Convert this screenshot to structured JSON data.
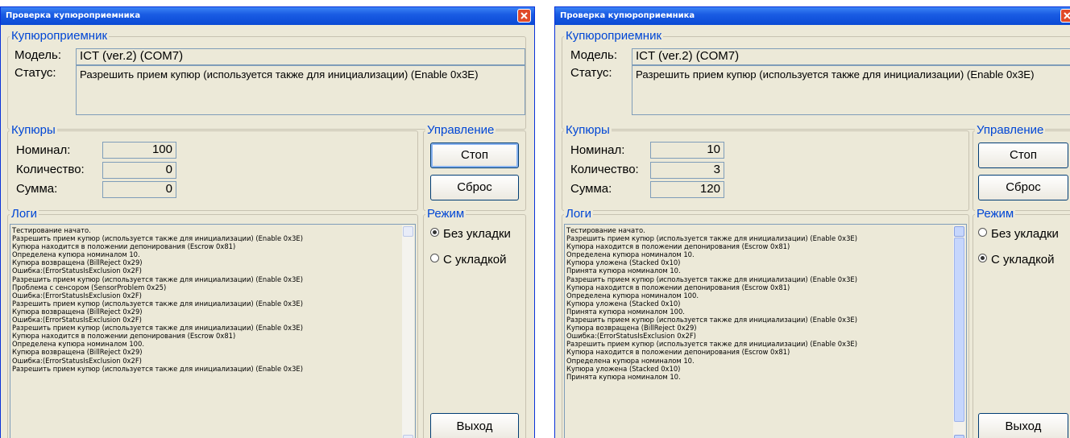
{
  "left": {
    "title": "Проверка купюроприемника",
    "acceptor_group": "Купюроприемник",
    "model_label": "Модель:",
    "model_value": "ICT (ver.2) (COM7)",
    "status_label": "Статус:",
    "status_value": "Разрешить прием купюр (используется также для инициализации) (Enable 0x3E)",
    "bills_group": "Купюры",
    "nominal_label": "Номинал:",
    "nominal_value": "100",
    "count_label": "Количество:",
    "count_value": "0",
    "sum_label": "Сумма:",
    "sum_value": "0",
    "control_group": "Управление",
    "stop_button": "Стоп",
    "reset_button": "Сброс",
    "logs_group": "Логи",
    "mode_group": "Режим",
    "mode_options": [
      "Без укладки",
      "С укладкой"
    ],
    "mode_selected": 0,
    "exit_button": "Выход",
    "logs": [
      "Тестирование начато.",
      "Разрешить прием купюр (используется также для инициализации) (Enable 0x3E)",
      "Купюра находится в положении депонирования (Escrow 0x81)",
      "Определена купюра номиналом 10.",
      "Купюра возвращена (BillReject 0x29)",
      "Ошибка:(ErrorStatusIsExclusion 0x2F)",
      "Разрешить прием купюр (используется также для инициализации) (Enable 0x3E)",
      "Проблема с сенсором (SensorProblem 0x25)",
      "Ошибка:(ErrorStatusIsExclusion 0x2F)",
      "Разрешить прием купюр (используется также для инициализации) (Enable 0x3E)",
      "Купюра возвращена (BillReject 0x29)",
      "Ошибка:(ErrorStatusIsExclusion 0x2F)",
      "Разрешить прием купюр (используется также для инициализации) (Enable 0x3E)",
      "Купюра находится в положении депонирования (Escrow 0x81)",
      "Определена купюра номиналом 100.",
      "Купюра возвращена (BillReject 0x29)",
      "Ошибка:(ErrorStatusIsExclusion 0x2F)",
      "Разрешить прием купюр (используется также для инициализации) (Enable 0x3E)"
    ]
  },
  "right": {
    "title": "Проверка купюроприемника",
    "acceptor_group": "Купюроприемник",
    "model_label": "Модель:",
    "model_value": "ICT (ver.2) (COM7)",
    "status_label": "Статус:",
    "status_value": "Разрешить прием купюр (используется также для инициализации) (Enable 0x3E)",
    "bills_group": "Купюры",
    "nominal_label": "Номинал:",
    "nominal_value": "10",
    "count_label": "Количество:",
    "count_value": "3",
    "sum_label": "Сумма:",
    "sum_value": "120",
    "control_group": "Управление",
    "stop_button": "Стоп",
    "reset_button": "Сброс",
    "logs_group": "Логи",
    "mode_group": "Режим",
    "mode_options": [
      "Без укладки",
      "С укладкой"
    ],
    "mode_selected": 1,
    "exit_button": "Выход",
    "logs": [
      "Тестирование начато.",
      "Разрешить прием купюр (используется также для инициализации) (Enable 0x3E)",
      "Купюра находится в положении депонирования (Escrow 0x81)",
      "Определена купюра номиналом 10.",
      "Купюра уложена (Stacked 0x10)",
      "Принята купюра номиналом 10.",
      "Разрешить прием купюр (используется также для инициализации) (Enable 0x3E)",
      "Купюра находится в положении депонирования (Escrow 0x81)",
      "Определена купюра номиналом 100.",
      "Купюра уложена (Stacked 0x10)",
      "Принята купюра номиналом 100.",
      "Разрешить прием купюр (используется также для инициализации) (Enable 0x3E)",
      "Купюра возвращена (BillReject 0x29)",
      "Ошибка:(ErrorStatusIsExclusion 0x2F)",
      "Разрешить прием купюр (используется также для инициализации) (Enable 0x3E)",
      "Купюра находится в положении депонирования (Escrow 0x81)",
      "Определена купюра номиналом 10.",
      "Купюра уложена (Stacked 0x10)",
      "Принята купюра номиналом 10."
    ]
  }
}
